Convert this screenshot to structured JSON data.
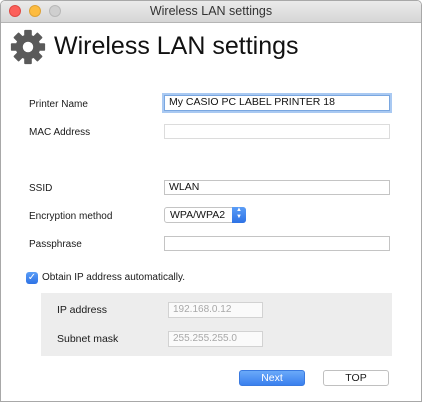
{
  "window": {
    "title": "Wireless LAN settings"
  },
  "header": {
    "title": "Wireless LAN settings",
    "icon": "gear-icon"
  },
  "form": {
    "printer_name": {
      "label": "Printer Name",
      "value": "My CASIO PC LABEL PRINTER 18"
    },
    "mac_address": {
      "label": "MAC Address",
      "value": ""
    },
    "ssid": {
      "label": "SSID",
      "value": "WLAN"
    },
    "encryption": {
      "label": "Encryption method",
      "selected": "WPA/WPA2"
    },
    "passphrase": {
      "label": "Passphrase",
      "value": ""
    },
    "obtain_ip": {
      "label": "Obtain IP address automatically.",
      "checked": true
    },
    "ip_address": {
      "label": "IP address",
      "placeholder": "192.168.0.12"
    },
    "subnet_mask": {
      "label": "Subnet mask",
      "placeholder": "255.255.255.0"
    }
  },
  "buttons": {
    "next": "Next",
    "top": "TOP"
  },
  "colors": {
    "accent": "#3a80ee",
    "close": "#fc605b",
    "minimize": "#fdbc40"
  }
}
